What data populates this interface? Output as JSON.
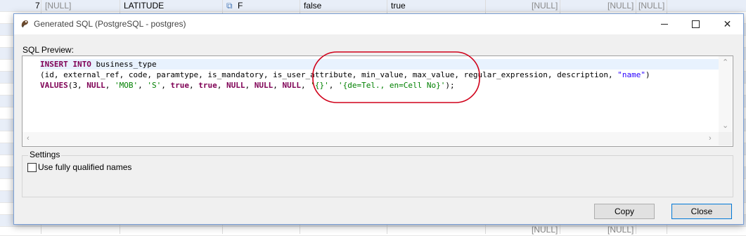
{
  "background_grid": {
    "top_row": {
      "row_number": "7",
      "cells": [
        "[NULL]",
        "LATITUDE",
        "F",
        "false",
        "true",
        "[NULL]",
        "[NULL]",
        "[NULL]"
      ]
    },
    "row_nulls": [
      "[NULL]",
      "[NULL]"
    ]
  },
  "dialog": {
    "title": "Generated SQL (PostgreSQL - postgres)",
    "section_label": "SQL Preview:",
    "sql_lines": [
      [
        {
          "t": "INSERT INTO ",
          "c": "kw"
        },
        {
          "t": "business_type",
          "c": ""
        }
      ],
      [
        {
          "t": "(id, external_ref, code, paramtype, is_mandatory, is_user_attribute, min_value, max_value, regular_expression, description, ",
          "c": ""
        },
        {
          "t": "\"name\"",
          "c": "str-dark"
        },
        {
          "t": ")",
          "c": ""
        }
      ],
      [
        {
          "t": "VALUES",
          "c": "kw"
        },
        {
          "t": "(3, ",
          "c": ""
        },
        {
          "t": "NULL",
          "c": "kw"
        },
        {
          "t": ", ",
          "c": ""
        },
        {
          "t": "'MOB'",
          "c": "str"
        },
        {
          "t": ", ",
          "c": ""
        },
        {
          "t": "'S'",
          "c": "str"
        },
        {
          "t": ", ",
          "c": ""
        },
        {
          "t": "true",
          "c": "kw"
        },
        {
          "t": ", ",
          "c": ""
        },
        {
          "t": "true",
          "c": "kw"
        },
        {
          "t": ", ",
          "c": ""
        },
        {
          "t": "NULL",
          "c": "kw"
        },
        {
          "t": ", ",
          "c": ""
        },
        {
          "t": "NULL",
          "c": "kw"
        },
        {
          "t": ", ",
          "c": ""
        },
        {
          "t": "NULL",
          "c": "kw"
        },
        {
          "t": ", ",
          "c": ""
        },
        {
          "t": "'{}'",
          "c": "str"
        },
        {
          "t": ", ",
          "c": ""
        },
        {
          "t": "'{de=Tel., en=Cell No}'",
          "c": "str"
        },
        {
          "t": ");",
          "c": ""
        }
      ]
    ],
    "settings": {
      "legend": "Settings",
      "checkbox_label": "Use fully qualified names",
      "checked": false
    },
    "buttons": {
      "copy": "Copy",
      "close": "Close"
    }
  },
  "colors": {
    "keyword": "#7f0055",
    "string": "#008000",
    "annotation_circle": "#d0021b",
    "alt_row": "#e8eef8"
  },
  "icons": {
    "title": "dbeaver-icon",
    "boolean_cell": "link-icon"
  }
}
